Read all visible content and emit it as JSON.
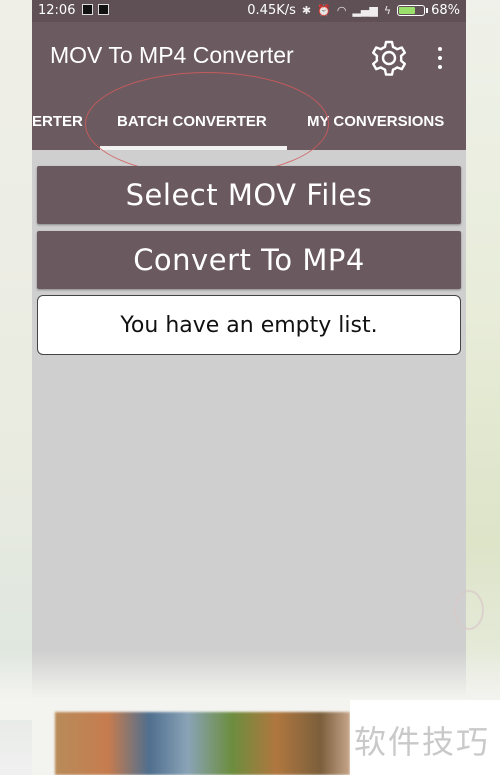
{
  "status_bar": {
    "time": "12:06",
    "network_speed": "0.45K/s",
    "battery_percent": "68%",
    "battery_level": 0.68,
    "icons": [
      "notification-icon",
      "notification-icon",
      "bluetooth-icon",
      "alarm-icon",
      "wifi-icon",
      "signal-icon",
      "charging-icon"
    ]
  },
  "app_bar": {
    "title": "MOV To MP4 Converter",
    "settings_icon": "gear-icon",
    "menu_icon": "more-vert-icon"
  },
  "tabs": [
    {
      "label": "ERTER"
    },
    {
      "label": "BATCH CONVERTER",
      "selected": true
    },
    {
      "label": "MY CONVERSIONS"
    }
  ],
  "main": {
    "select_button_label": "Select MOV Files",
    "convert_button_label": "Convert To MP4",
    "empty_message": "You have an empty list."
  },
  "watermark": "软件技巧",
  "colors": {
    "toolbar": "#6b5b61",
    "status_bar": "#5e5055",
    "content_bg": "#cfcfcf",
    "button": "#6a5a60",
    "annotation": "#d45a5a"
  }
}
